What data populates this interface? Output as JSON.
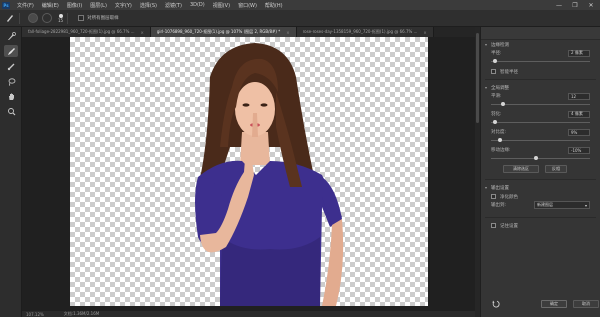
{
  "app": {
    "logo": "Ps"
  },
  "menubar": {
    "items": [
      "文件(F)",
      "编辑(E)",
      "图像(I)",
      "图层(L)",
      "文字(Y)",
      "选择(S)",
      "滤镜(T)",
      "3D(D)",
      "视图(V)",
      "窗口(W)",
      "帮助(H)"
    ],
    "window_controls": [
      "—",
      "❐",
      "✕"
    ]
  },
  "optionsbar": {
    "brush_size": "15",
    "checkbox_label": "对所有图层取样"
  },
  "tabs": [
    {
      "label": "fall-foliage-2822981_960_720-抠图(1).jpg @ 66.7% ...",
      "active": false
    },
    {
      "label": "girl-1076898_960_720-抠图(1).jpg @ 107% (图层 2, RGB/8#) *",
      "active": true
    },
    {
      "label": "rose-roses-day-1358159_960_720-抠图(1).jpg @ 66.7% ...",
      "active": false
    }
  ],
  "status": {
    "zoom": "107.12%",
    "doc": "文档:1.36M/2.16M"
  },
  "panel": {
    "title": "",
    "edge_detection": {
      "heading": "边缘检测",
      "radius_label": "半径:",
      "radius_value": "2 像素",
      "radius_level": 0.04,
      "smart_radius_label": "智能半径"
    },
    "global_refine": {
      "heading": "全局调整",
      "smooth_label": "平滑:",
      "smooth_value": "12",
      "smooth_level": 0.12,
      "feather_label": "羽化:",
      "feather_value": "4 像素",
      "feather_level": 0.04,
      "contrast_label": "对比度:",
      "contrast_value": "9%",
      "contrast_level": 0.09,
      "shift_label": "移动边缘:",
      "shift_value": "-10%",
      "shift_level": 0.45,
      "clear_button": "清除选区",
      "invert_button": "反相"
    },
    "output": {
      "heading": "输出设置",
      "decontaminate_label": "净化颜色",
      "output_to_label": "输出到:",
      "output_to_value": "新建图层",
      "remember_label": "记住设置"
    },
    "footer": {
      "reset_icon": "reset-icon",
      "ok_button": "确定",
      "cancel_button": "取消"
    }
  },
  "colors": {
    "accent": "#3da5f4",
    "shirt": "#3d2f8e"
  }
}
